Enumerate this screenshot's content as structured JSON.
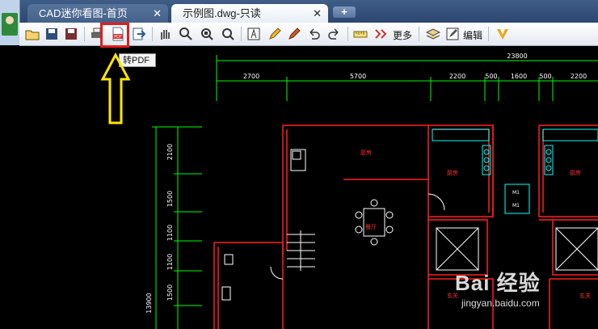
{
  "tabs": [
    {
      "label": "CAD迷你看图-首页",
      "close": "✕"
    },
    {
      "label": "示例图.dwg-只读",
      "close": "✕"
    }
  ],
  "new_tab": "+",
  "toolbar": {
    "more_label": "更多",
    "edit_label": "编辑",
    "pdf_icon_text": "PDF"
  },
  "tooltip": "转PDF",
  "drawing": {
    "dim_total": "23800",
    "dims_top": [
      "2700",
      "5700",
      "2200",
      "500",
      "1600",
      "500",
      "2200"
    ],
    "dims_left": [
      "2100",
      "1500",
      "1100",
      "1100",
      "1500",
      "13900"
    ],
    "room_labels": [
      "厨房",
      "厨房",
      "厨房",
      "餐厅",
      "玄关",
      "玄关"
    ],
    "door_tags": [
      "M1",
      "M1"
    ]
  },
  "watermark": {
    "logo": "Bai  经验",
    "url": "jingyan.baidu.com"
  },
  "colors": {
    "highlight": "#e21d1d",
    "arrow": "#ffe600",
    "wall": "#ff2020",
    "dim": "#00ff00",
    "fixture": "#00ffff"
  }
}
